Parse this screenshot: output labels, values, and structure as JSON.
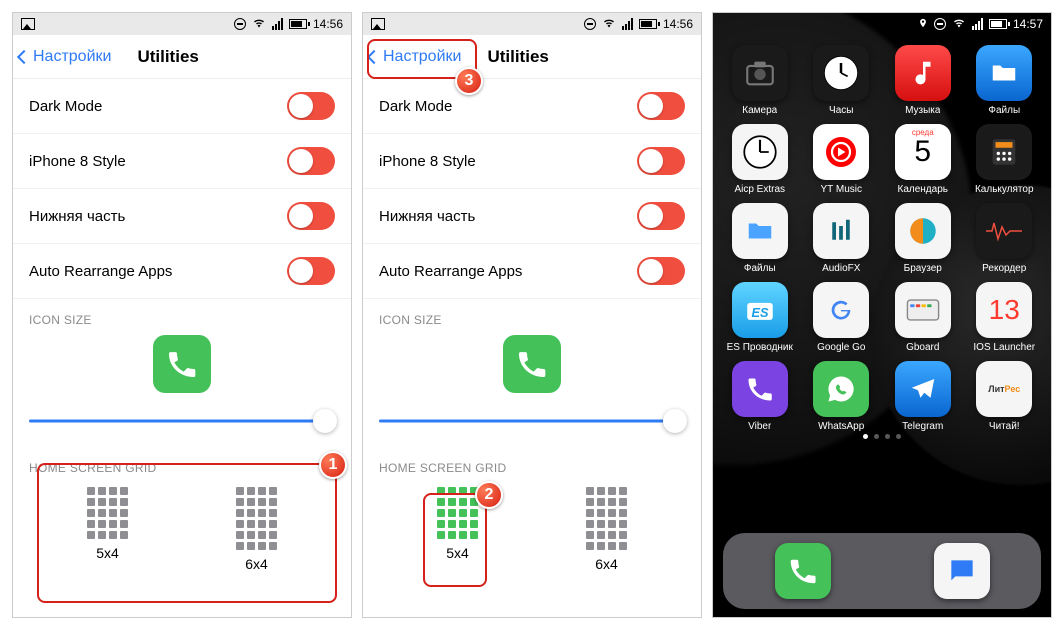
{
  "status": {
    "time1": "14:56",
    "time2": "14:56",
    "time3": "14:57"
  },
  "nav": {
    "back": "Настройки",
    "title": "Utilities"
  },
  "toggles": [
    {
      "label": "Dark Mode",
      "on": false
    },
    {
      "label": "iPhone 8 Style",
      "on": false
    },
    {
      "label": "Нижняя часть",
      "on": false
    },
    {
      "label": "Auto Rearrange Apps",
      "on": false
    }
  ],
  "sections": {
    "iconSize": "ICON SIZE",
    "homeGrid": "HOME SCREEN GRID"
  },
  "grid": {
    "opt1": "5x4",
    "opt2": "6x4"
  },
  "badges": {
    "b1": "1",
    "b2": "2",
    "b3": "3"
  },
  "apps": [
    {
      "name": "Камера",
      "style": "ic-dark"
    },
    {
      "name": "Часы",
      "style": "ic-dark"
    },
    {
      "name": "Музыка",
      "style": "ic-red"
    },
    {
      "name": "Файлы",
      "style": "ic-gradblue"
    },
    {
      "name": "Aicp Extras",
      "style": "ic-white"
    },
    {
      "name": "YT Music",
      "style": "ic-ytm"
    },
    {
      "name": "Календарь",
      "style": "ic-white",
      "cal_day": "среда",
      "cal_num": "5"
    },
    {
      "name": "Калькулятор",
      "style": "ic-dark"
    },
    {
      "name": "Файлы",
      "style": "ic-white"
    },
    {
      "name": "AudioFX",
      "style": "ic-white"
    },
    {
      "name": "Браузер",
      "style": "ic-white"
    },
    {
      "name": "Рекордер",
      "style": "ic-dark"
    },
    {
      "name": "ES Проводник",
      "style": "ic-cyan"
    },
    {
      "name": "Google Go",
      "style": "ic-white"
    },
    {
      "name": "Gboard",
      "style": "ic-white"
    },
    {
      "name": "IOS Launcher",
      "style": "ic-white"
    },
    {
      "name": "Viber",
      "style": "ic-purple"
    },
    {
      "name": "WhatsApp",
      "style": "ic-green"
    },
    {
      "name": "Telegram",
      "style": "ic-gradblue"
    },
    {
      "name": "Читай!",
      "style": "ic-white"
    }
  ],
  "dock": [
    {
      "name": "phone",
      "style": "ic-green"
    },
    {
      "name": "messages",
      "style": "ic-white"
    }
  ]
}
